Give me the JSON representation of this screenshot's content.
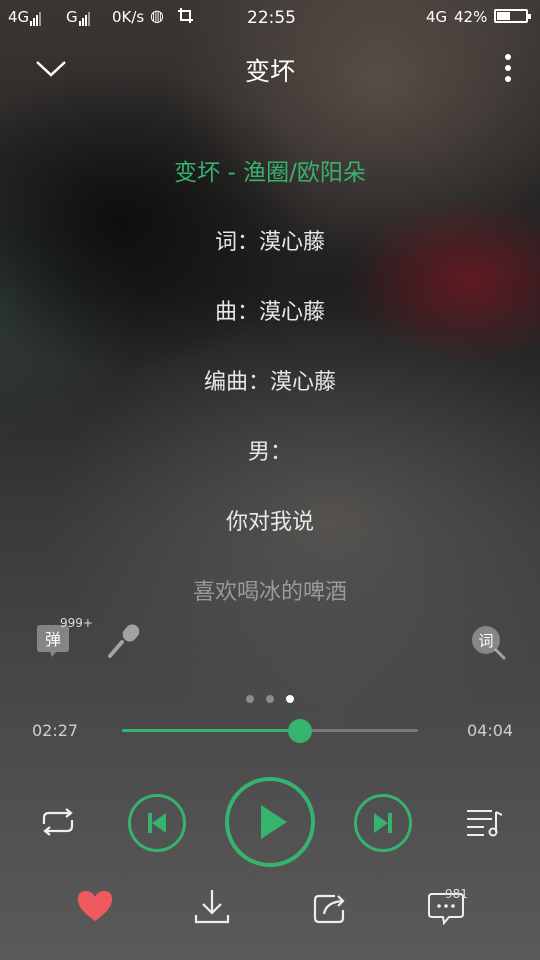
{
  "status_bar": {
    "network1": "4G",
    "network2": "G",
    "speed": "0K/s",
    "time": "22:55",
    "network_right": "4G",
    "battery": "42%"
  },
  "header": {
    "title": "变坏",
    "back_icon": "chevron-down-icon",
    "more_icon": "more-vertical-icon"
  },
  "lyrics": [
    {
      "text": "变坏 - 渔圈/欧阳朵",
      "state": "active"
    },
    {
      "text": "词：漠心藤",
      "state": "normal"
    },
    {
      "text": "曲：漠心藤",
      "state": "normal"
    },
    {
      "text": "编曲：漠心藤",
      "state": "normal"
    },
    {
      "text": "男：",
      "state": "normal"
    },
    {
      "text": "你对我说",
      "state": "normal"
    },
    {
      "text": "喜欢喝冰的啤酒",
      "state": "dim"
    }
  ],
  "tools": {
    "danmaku_label": "弹",
    "danmaku_count": "999+",
    "lyric_search_label": "词"
  },
  "pager": {
    "count": 3,
    "active_index": 2
  },
  "progress": {
    "current": "02:27",
    "total": "04:04",
    "fraction": 0.6
  },
  "actions": {
    "comment_count": "981"
  },
  "colors": {
    "accent": "#36b36f",
    "heart": "#ef5a5f"
  }
}
